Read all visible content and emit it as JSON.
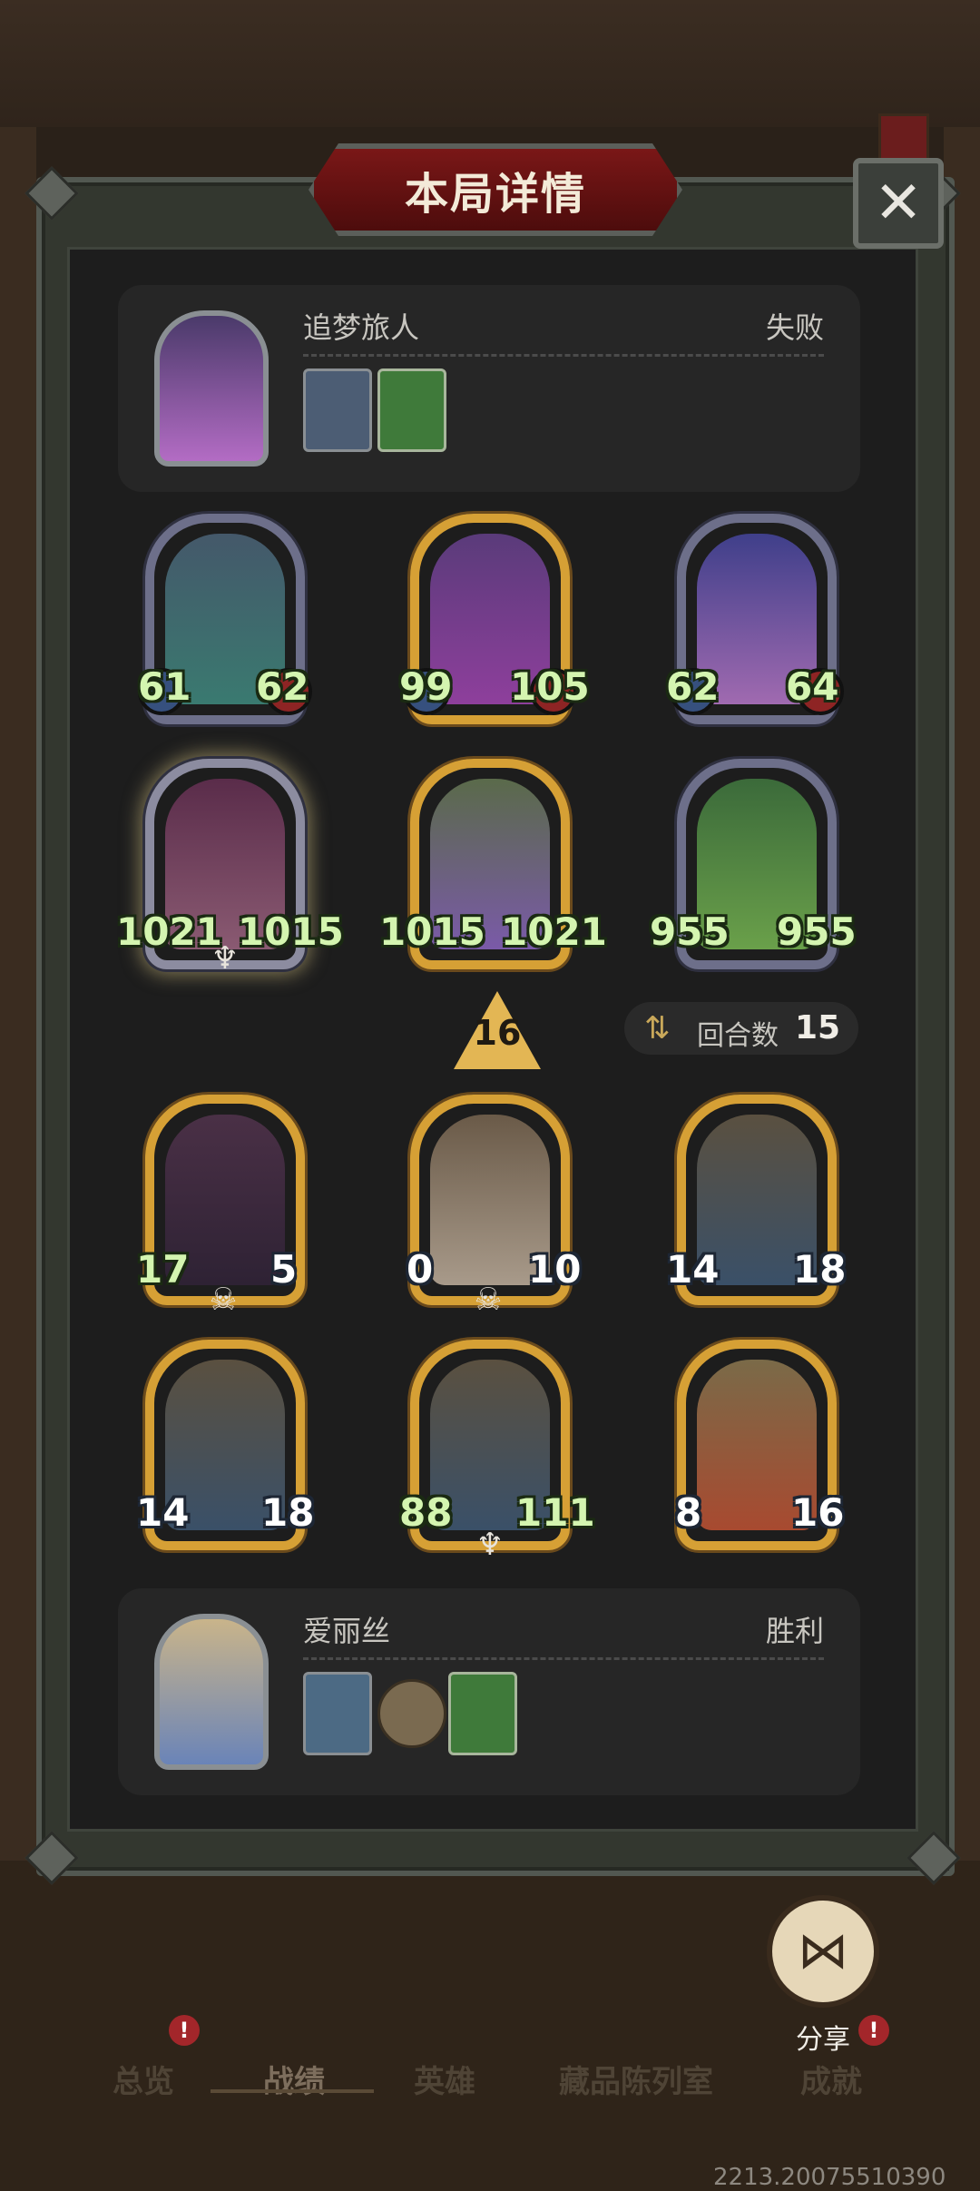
{
  "title": "本局详情",
  "close_symbol": "✕",
  "top_player": {
    "name": "追梦旅人",
    "result": "失败",
    "items": [
      "hero-portrait-icon",
      "green-book-icon"
    ]
  },
  "bottom_player": {
    "name": "爱丽丝",
    "result": "胜利",
    "items": [
      "hero-portrait-icon",
      "pocket-watch-icon",
      "green-book-icon"
    ]
  },
  "top_board": [
    {
      "atk": "61",
      "hp": "62"
    },
    {
      "atk": "99",
      "hp": "105"
    },
    {
      "atk": "62",
      "hp": "64"
    },
    {
      "atk": "1021",
      "hp": "1015"
    },
    {
      "atk": "1015",
      "hp": "1021"
    },
    {
      "atk": "955",
      "hp": "955"
    }
  ],
  "bottom_board": [
    {
      "atk": "17",
      "hp": "5"
    },
    {
      "atk": "0",
      "hp": "10"
    },
    {
      "atk": "14",
      "hp": "18"
    },
    {
      "atk": "14",
      "hp": "18"
    },
    {
      "atk": "88",
      "hp": "111"
    },
    {
      "atk": "8",
      "hp": "16"
    }
  ],
  "tier_badge": "16",
  "rounds": {
    "label": "回合数",
    "value": "15"
  },
  "share": {
    "label": "分享",
    "icon": "share-icon"
  },
  "tabs": [
    "总览",
    "战绩",
    "英雄",
    "藏品陈列室",
    "成就"
  ],
  "badge_mark": "!",
  "version": "2213.20075510390"
}
